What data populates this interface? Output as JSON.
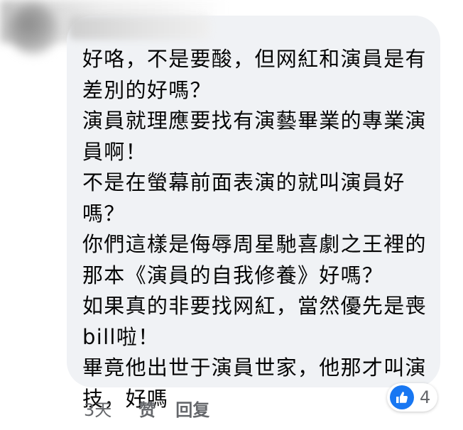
{
  "comment": {
    "lines": [
      "好咯，不是要酸，但网紅和演員是有",
      "差別的好嗎？",
      "演員就理應要找有演藝畢業的專業演",
      "員啊！",
      "不是在螢幕前面表演的就叫演員好",
      "嗎？",
      "你們這樣是侮辱周星馳喜劇之王裡的",
      "那本《演員的自我修養》好嗎？",
      "如果真的非要找网紅，當然優先是喪",
      "bill啦！",
      "畢竟他出世于演員世家，他那才叫演",
      "技，好嗎"
    ],
    "reactions": {
      "icon": "thumbs-up-icon",
      "count": "4",
      "color": "#1877f2"
    }
  },
  "actions": {
    "time": "3天",
    "like_label": "赞",
    "reply_label": "回复"
  },
  "colors": {
    "bubble": "#f0f2f5",
    "text": "#050505",
    "secondary_text": "#65676b"
  }
}
